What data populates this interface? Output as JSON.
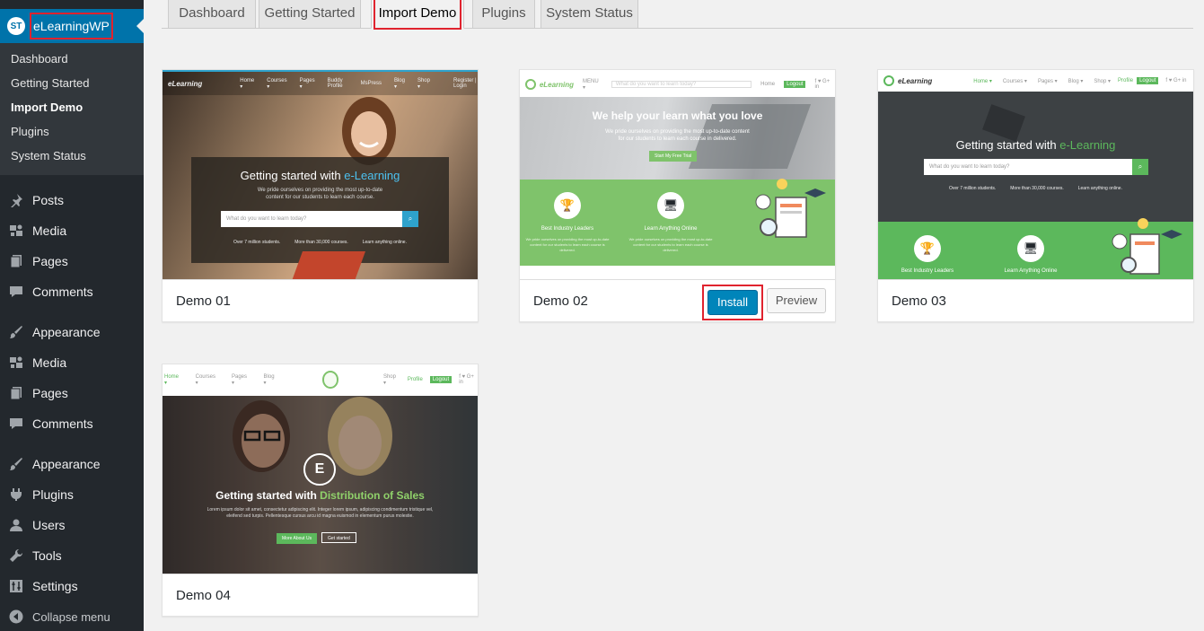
{
  "brand": {
    "label": "eLearningWP",
    "logo_text": "ST"
  },
  "submenu": [
    {
      "label": "Dashboard",
      "active": false
    },
    {
      "label": "Getting Started",
      "active": false
    },
    {
      "label": "Import Demo",
      "active": true
    },
    {
      "label": "Plugins",
      "active": false
    },
    {
      "label": "System Status",
      "active": false
    }
  ],
  "menu": [
    {
      "label": "Posts",
      "icon": "pushpin-icon"
    },
    {
      "label": "Media",
      "icon": "media-icon"
    },
    {
      "label": "Pages",
      "icon": "pages-icon"
    },
    {
      "label": "Comments",
      "icon": "comment-icon"
    },
    {
      "label": "Appearance",
      "icon": "paintbrush-icon"
    },
    {
      "label": "Media",
      "icon": "media-icon"
    },
    {
      "label": "Pages",
      "icon": "pages-icon"
    },
    {
      "label": "Comments",
      "icon": "comment-icon"
    },
    {
      "label": "Appearance",
      "icon": "paintbrush-icon"
    },
    {
      "label": "Plugins",
      "icon": "plugin-icon"
    },
    {
      "label": "Users",
      "icon": "users-icon"
    },
    {
      "label": "Tools",
      "icon": "wrench-icon"
    },
    {
      "label": "Settings",
      "icon": "settings-icon"
    },
    {
      "label": "Collapse menu",
      "icon": "collapse-icon"
    }
  ],
  "tabs": [
    {
      "label": "Dashboard"
    },
    {
      "label": "Getting Started"
    },
    {
      "label": "Import Demo",
      "active": true
    },
    {
      "label": "Plugins"
    },
    {
      "label": "System Status"
    }
  ],
  "demos": [
    {
      "name": "Demo 01"
    },
    {
      "name": "Demo 02",
      "install_label": "Install",
      "preview_label": "Preview"
    },
    {
      "name": "Demo 03"
    },
    {
      "name": "Demo 04"
    }
  ],
  "thumbs": {
    "d1": {
      "logo": "eLearning",
      "nav": [
        "Home ▾",
        "Courses ▾",
        "Pages ▾",
        "Buddy Profile",
        "MsPress",
        "Blog ▾",
        "Shop ▾"
      ],
      "auth": "Register | Login",
      "title_a": "Getting started with ",
      "title_b": "e-Learning",
      "sub": "We pride ourselves on providing the most up-to-date content for our students to learn each course.",
      "search_placeholder": "What do you want to learn today?",
      "stats": [
        "Over 7 million students.",
        "More than 30,000 courses.",
        "Learn anything online."
      ]
    },
    "d2": {
      "logo": "eLearning",
      "menu": "MENU ▾",
      "search": "What do you want to learn today?",
      "home": "Home",
      "logout": "Logout",
      "social": "f  ♥  G+  in",
      "title": "We help your learn what you love",
      "sub": "We pride ourselves on providing the most up-to-date content for our students to learn each course in delivered.",
      "cta": "Start My Free Trial",
      "feat1": "Best Industry Leaders",
      "feat2": "Learn Anything Online",
      "feat_desc": "We pride ourselves on providing the most up-to-date content for our students to learn each course is delivered."
    },
    "d3": {
      "logo": "eLearning",
      "nav": [
        "Home ▾",
        "Courses ▾",
        "Pages ▾",
        "Blog ▾",
        "Shop ▾",
        "Profile"
      ],
      "logout": "Logout",
      "social": "f  ♥  G+  in",
      "title_a": "Getting started with ",
      "title_b": "e-Learning",
      "search_placeholder": "What do you want to learn today?",
      "stats": [
        "Over 7 million students.",
        "More than 30,000 courses.",
        "Learn anything online."
      ],
      "feat1": "Best Industry Leaders",
      "feat2": "Learn Anything Online"
    },
    "d4": {
      "nav": [
        "Home ▾",
        "Courses ▾",
        "Pages ▾",
        "Blog ▾"
      ],
      "right": [
        "Shop ▾",
        "Profile"
      ],
      "logout": "Logout",
      "social": "f  ♥  G+  in",
      "title_a": "Getting started with ",
      "title_b": "Distribution of Sales",
      "sub": "Lorem ipsum dolor sit amet, consectetur adipiscing elit. Integer lorem ipsum, adipiscing condimentum tristique vel, eleifend sed turpis. Pellentesque cursus arcu id magna euismod in elementum purus molestie.",
      "btn1": "More About Us",
      "btn2": "Get started"
    }
  },
  "colors": {
    "accent": "#0073aa",
    "highlight": "#e0232e",
    "green": "#5cb85c",
    "sidebar": "#23282d"
  }
}
